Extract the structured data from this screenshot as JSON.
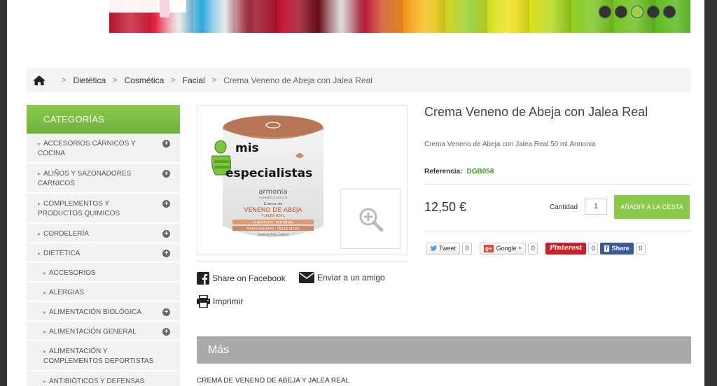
{
  "banner": {
    "slides": 5,
    "active_slide": 3
  },
  "breadcrumb": {
    "items": [
      "Dietética",
      "Cosmética",
      "Facial",
      "Crema Veneno de Abeja con Jalea Real"
    ]
  },
  "sidebar": {
    "header": "CATEGORÍAS",
    "items": [
      {
        "label": "ACCESORIOS CÁRNICOS Y COCINA",
        "expandable": true
      },
      {
        "label": "ALIÑOS Y SAZONADORES CARNICOS",
        "expandable": true
      },
      {
        "label": "COMPLEMENTOS Y PRODUCTOS QUIMICOS",
        "expandable": true
      },
      {
        "label": "CORDELERÍA",
        "expandable": true
      },
      {
        "label": "DIETÉTICA",
        "expandable": true
      },
      {
        "label": "ACCESORIOS",
        "expandable": false
      },
      {
        "label": "ALERGIAS",
        "expandable": false
      },
      {
        "label": "ALIMENTACIÓN BIOLÓGICA",
        "expandable": true
      },
      {
        "label": "ALIMENTACIÓN GENERAL",
        "expandable": true
      },
      {
        "label": "ALIMENTACIÓN Y COMPLEMENTOS DEPORTISTAS",
        "expandable": false
      },
      {
        "label": "ANTIBIÓTICOS Y DEFENSAS",
        "expandable": false
      }
    ]
  },
  "product": {
    "title": "Crema Veneno de Abeja con Jalea Real",
    "short_desc": "Crema Veneno de Abeja con Jalea Real 50 ml.Armonia",
    "ref_label": "Referencia:",
    "ref_code": "DGB058",
    "price": "12,50 €",
    "qty_label": "Cantidad",
    "qty_value": "1",
    "add_to_cart": "AÑADIR A LA CESTA",
    "image": {
      "watermark_line1": "mis",
      "watermark_line2": "especialistas",
      "brand": "armonia",
      "brand_sub": "cosmética natural",
      "line1": "Crema de",
      "line2": "VENENO DE ABEJA",
      "line3": "Y JALEA REAL",
      "line4": "HIDRATANTE · NUTRITIVA",
      "line5": "PIELES MADURAS - PIELES SECAS",
      "line6": "Contiene fitico solares"
    }
  },
  "actions": {
    "share_facebook": "Share on Facebook",
    "send_friend": "Enviar a un amigo",
    "print": "Imprimir"
  },
  "social": {
    "tweet": "Tweet",
    "tweet_count": "0",
    "google_g": "g+",
    "google": "Google +",
    "google_count": "0",
    "pinterest": "Pinterest",
    "pinterest_count": "0",
    "fb_share": "Share",
    "fb_count": "0"
  },
  "more": {
    "title": "Más",
    "text": "CREMA DE VENENO DE ABEJA Y JALEA REAL"
  },
  "colors": {
    "accent_green": "#8cc84b",
    "ref_green": "#3a9b2a",
    "more_bar": "#aaaaaa"
  }
}
